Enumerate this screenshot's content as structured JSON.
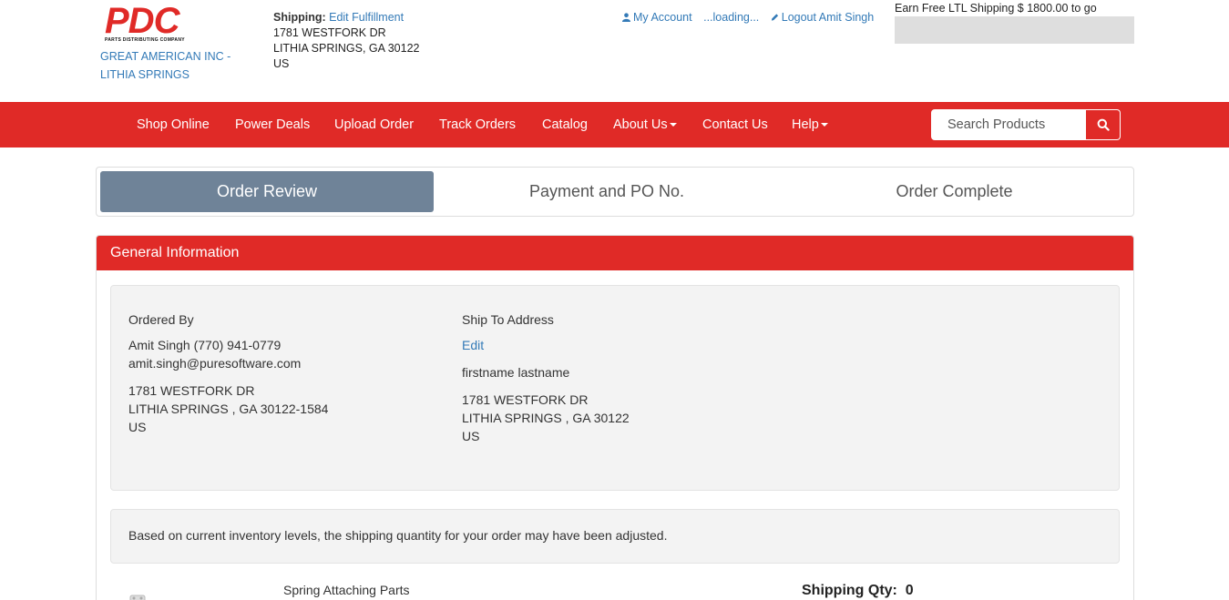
{
  "header": {
    "logo_text": "PDC",
    "logo_subtext": "PARTS DISTRIBUTING COMPANY",
    "company_line1": "GREAT AMERICAN INC -",
    "company_line2": "LITHIA SPRINGS",
    "shipping_label": "Shipping:",
    "edit_fulfillment": "Edit Fulfillment",
    "ship_line1": "1781 WESTFORK DR",
    "ship_line2": "LITHIA SPRINGS, GA 30122",
    "ship_line3": "US",
    "my_account": "My Account",
    "loading": "...loading...",
    "logout": "Logout Amit Singh",
    "ltl_text": "Earn Free LTL Shipping $ 1800.00 to go"
  },
  "nav": {
    "items": [
      "Shop Online",
      "Power Deals",
      "Upload Order",
      "Track Orders",
      "Catalog",
      "About Us",
      "Contact Us",
      "Help"
    ],
    "search_placeholder": "Search Products"
  },
  "steps": [
    "Order Review",
    "Payment and PO No.",
    "Order Complete"
  ],
  "general": {
    "title": "General Information",
    "ordered_by_label": "Ordered By",
    "ordered_by_name_phone": "Amit Singh (770) 941-0779",
    "ordered_by_email": "amit.singh@puresoftware.com",
    "ordered_by_addr1": "1781 WESTFORK DR",
    "ordered_by_addr2": "LITHIA SPRINGS , GA  30122-1584",
    "ordered_by_addr3": "US",
    "ship_to_label": "Ship To Address",
    "ship_to_edit": "Edit",
    "ship_to_name": "firstname  lastname",
    "ship_to_addr1": "1781 WESTFORK DR",
    "ship_to_addr2": "LITHIA SPRINGS , GA  30122",
    "ship_to_addr3": "US",
    "notice": "Based on current inventory levels, the shipping quantity for your order may have been adjusted."
  },
  "product": {
    "name": "Spring Attaching Parts",
    "ship_qty_label": "Shipping Qty:",
    "ship_qty_value": "0"
  },
  "colors": {
    "brand_red": "#e02a27",
    "active_step": "#6f8398",
    "link": "#337ab7"
  }
}
